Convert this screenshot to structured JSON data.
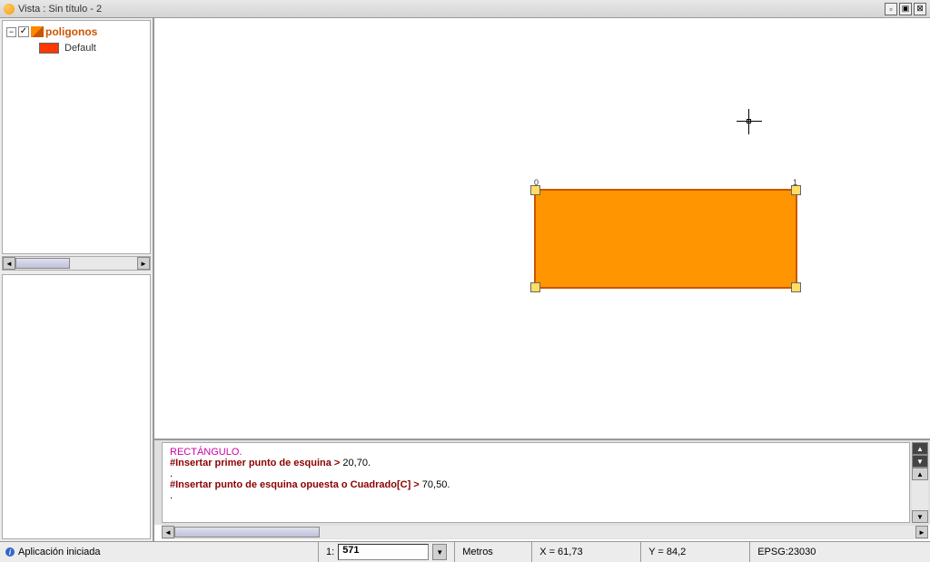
{
  "titlebar": {
    "title": "Vista : Sin título -  2"
  },
  "layers": {
    "root_name": "poligonos",
    "root_checked": true,
    "default_label": "Default",
    "default_color": "#ff3800"
  },
  "shape": {
    "handle_labels": {
      "tl": "0",
      "tr": "1"
    }
  },
  "console": {
    "line1_cmd": "RECTÁNGULO",
    "line2_prompt": "#Insertar primer punto de esquina >",
    "line2_val": " 20,70.",
    "line3": ".",
    "line4_prompt": "#Insertar punto de esquina opuesta o Cuadrado[C] >",
    "line4_val": " 70,50.",
    "line5": "."
  },
  "status": {
    "app_started": "Aplicación iniciada",
    "scale_prefix": "1:",
    "scale_value": "571",
    "units": "Metros",
    "x_label": "X = 61,73",
    "y_label": "Y = 84,2",
    "epsg": "EPSG:23030"
  }
}
